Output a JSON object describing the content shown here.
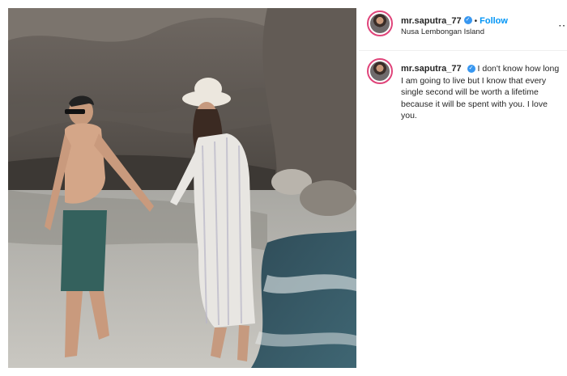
{
  "post": {
    "username": "mr.saputra_77",
    "location": "Nusa Lembongan Island",
    "follow_label": "Follow",
    "separator": "•",
    "verified_glyph": "✓",
    "caption": "I don't know how long I am going to live but I know that every single second will be worth a lifetime because it will be spent with you. I love you.",
    "photo_description": "couple holding hands walking on a rocky beach"
  },
  "colors": {
    "follow": "#0095f6",
    "verified": "#3897f0",
    "avatar_ring": "#e0447a"
  },
  "icons": {
    "more": "more-options-icon",
    "verified": "verified-badge-icon"
  }
}
